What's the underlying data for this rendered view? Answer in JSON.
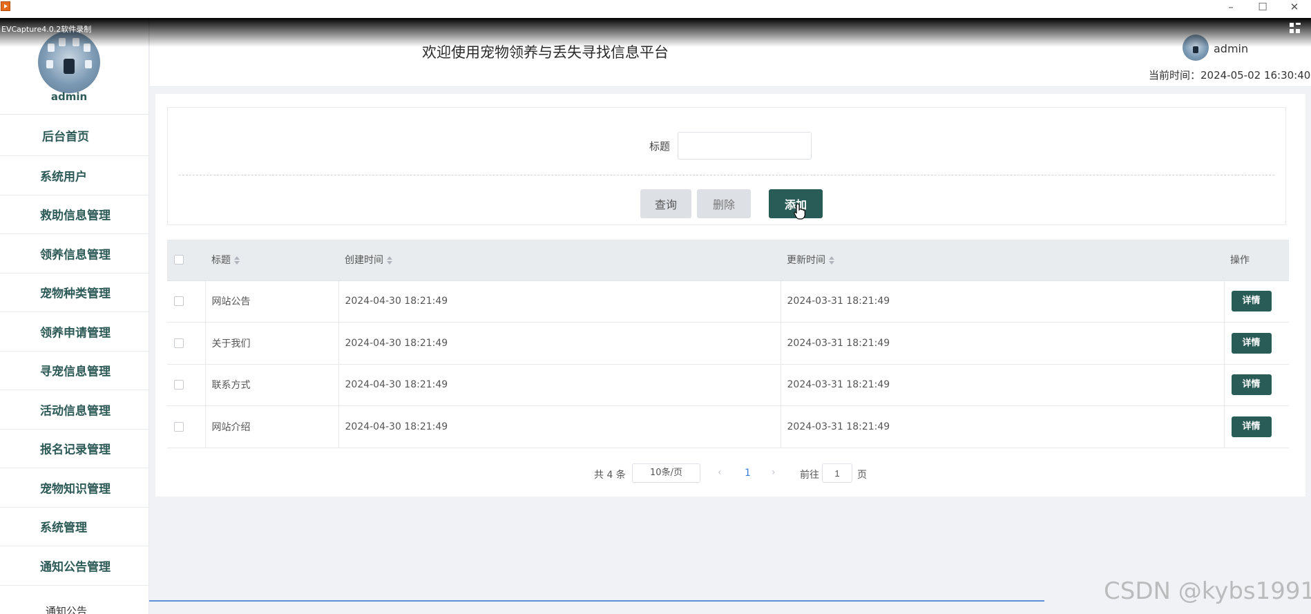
{
  "window": {
    "minimize_glyph": "–",
    "maximize_glyph": "☐",
    "close_glyph": "✕",
    "recorder_label": "EVCapture4.0.2软件录制"
  },
  "sidebar": {
    "username": "admin",
    "items": [
      {
        "label": "后台首页"
      },
      {
        "label": "系统用户"
      },
      {
        "label": "救助信息管理"
      },
      {
        "label": "领养信息管理"
      },
      {
        "label": "宠物种类管理"
      },
      {
        "label": "领养申请管理"
      },
      {
        "label": "寻宠信息管理"
      },
      {
        "label": "活动信息管理"
      },
      {
        "label": "报名记录管理"
      },
      {
        "label": "宠物知识管理"
      },
      {
        "label": "系统管理"
      },
      {
        "label": "通知公告管理"
      }
    ],
    "partial_item": "通知公告"
  },
  "header": {
    "title": "欢迎使用宠物领养与丢失寻找信息平台",
    "user": "admin",
    "time_label": "当前时间：2024-05-02 16:30:40"
  },
  "search": {
    "label": "标题",
    "value": "",
    "query_label": "查询",
    "delete_label": "删除",
    "add_label": "添加"
  },
  "table": {
    "columns": [
      "标题",
      "创建时间",
      "更新时间",
      "操作"
    ],
    "rows": [
      {
        "title": "网站公告",
        "created": "2024-04-30 18:21:49",
        "updated": "2024-03-31 18:21:49",
        "action": "详情"
      },
      {
        "title": "关于我们",
        "created": "2024-04-30 18:21:49",
        "updated": "2024-03-31 18:21:49",
        "action": "详情"
      },
      {
        "title": "联系方式",
        "created": "2024-04-30 18:21:49",
        "updated": "2024-03-31 18:21:49",
        "action": "详情"
      },
      {
        "title": "网站介绍",
        "created": "2024-04-30 18:21:49",
        "updated": "2024-03-31 18:21:49",
        "action": "详情"
      }
    ]
  },
  "pagination": {
    "total": "共 4 条",
    "page_size": "10条/页",
    "prev": "‹",
    "current": "1",
    "next": "›",
    "goto_label": "前往",
    "goto_value": "1",
    "page_suffix": "页"
  },
  "watermark": "CSDN @kybs1991",
  "colors": {
    "primary": "#2a5c57",
    "sidebar_text": "#2d5a57",
    "link": "#3a7bd5",
    "background": "#f0f2f5"
  }
}
